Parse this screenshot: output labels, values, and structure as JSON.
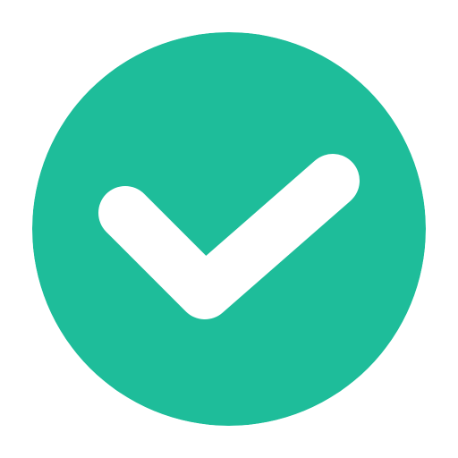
{
  "icon": {
    "name": "check-circle-icon",
    "background_color": "#1EBD9A",
    "mark_color": "#FFFFFF",
    "page_color": "#FFFFFF"
  }
}
